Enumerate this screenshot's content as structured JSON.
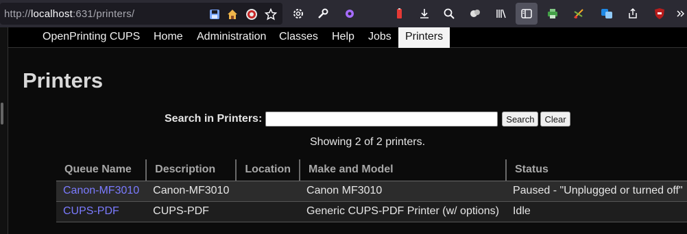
{
  "browser": {
    "url_prefix": "http://",
    "url_host": "localhost",
    "url_rest": ":631/printers/"
  },
  "nav": {
    "items": [
      {
        "label": "OpenPrinting CUPS"
      },
      {
        "label": "Home"
      },
      {
        "label": "Administration"
      },
      {
        "label": "Classes"
      },
      {
        "label": "Help"
      },
      {
        "label": "Jobs"
      },
      {
        "label": "Printers"
      }
    ],
    "active": "Printers"
  },
  "page": {
    "title": "Printers",
    "search_label": "Search in Printers:",
    "search_value": "",
    "search_button": "Search",
    "clear_button": "Clear",
    "showing": "Showing 2 of 2 printers."
  },
  "table": {
    "headers": [
      "Queue Name",
      "Description",
      "Location",
      "Make and Model",
      "Status"
    ],
    "rows": [
      {
        "queue": "Canon-MF3010",
        "description": "Canon-MF3010",
        "location": "",
        "model": "Canon MF3010",
        "status": "Paused - \"Unplugged or turned off\""
      },
      {
        "queue": "CUPS-PDF",
        "description": "CUPS-PDF",
        "location": "",
        "model": "Generic CUPS-PDF Printer (w/ options)",
        "status": "Idle"
      }
    ]
  },
  "toolbar_icons": [
    "save-page-icon",
    "home-icon",
    "tracker-icon",
    "bookmark-star-icon",
    "settings-gear-icon",
    "wrench-icon",
    "extension-puzzle-icon",
    "battery-icon",
    "downloads-icon",
    "zoom-icon",
    "containers-icon",
    "library-icon",
    "sidebar-icon",
    "printer-icon",
    "scissors-icon",
    "translate-icon",
    "share-icon",
    "ublock-icon",
    "overflow-chevron-icon"
  ],
  "colors": {
    "link": "#7b7bff",
    "active_tab_bg": "#f4f4f4"
  }
}
